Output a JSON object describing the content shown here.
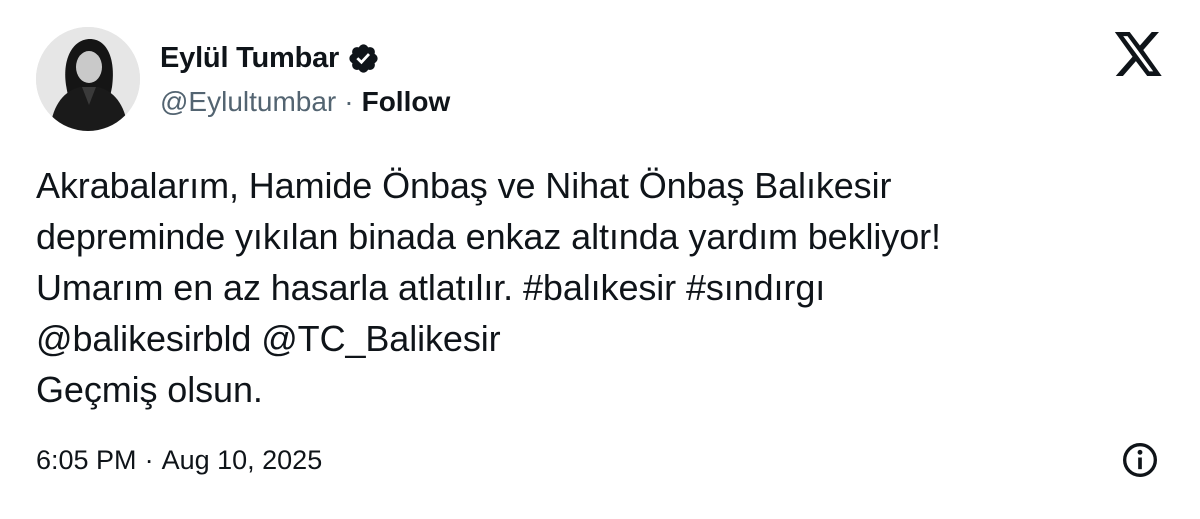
{
  "author": {
    "display_name": "Eylül Tumbar",
    "handle": "@Eylultumbar",
    "separator": "·",
    "follow_label": "Follow",
    "verified_icon": "verified-badge-icon"
  },
  "tweet": {
    "lines": [
      "Akrabalarım, Hamide Önbaş ve Nihat Önbaş Balıkesir",
      "depreminde yıkılan binada enkaz altında yardım bekliyor!",
      "Umarım en az hasarla atlatılır. #balıkesir #sındırgı",
      "@balikesirbld @TC_Balikesir",
      "Geçmiş olsun."
    ]
  },
  "meta": {
    "time": "6:05 PM",
    "separator": "·",
    "date": "Aug 10, 2025"
  },
  "icons": {
    "brand": "x-logo-icon",
    "info": "info-icon"
  },
  "colors": {
    "text_primary": "#0f1419",
    "text_secondary": "#536471",
    "background": "#ffffff"
  }
}
